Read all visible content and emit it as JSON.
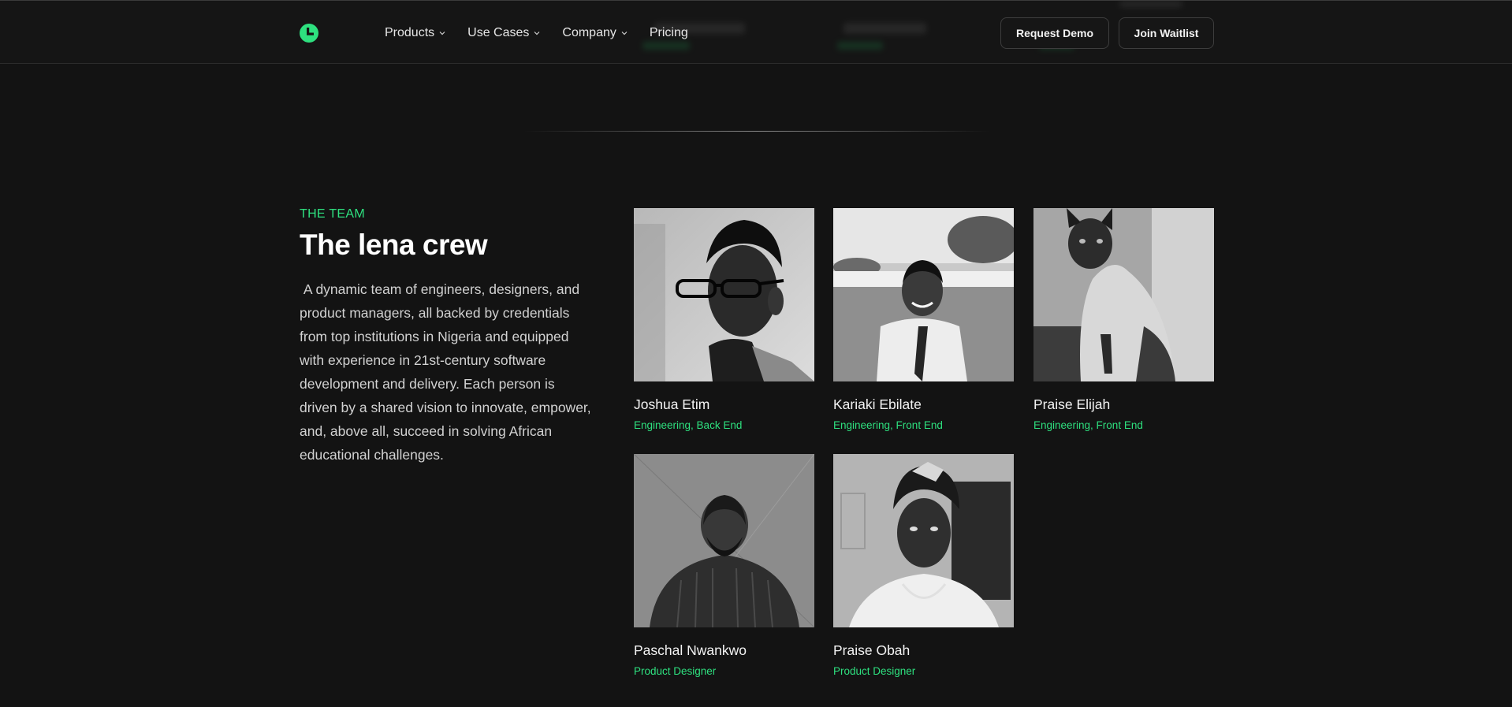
{
  "nav": {
    "items": [
      {
        "label": "Products",
        "has_dropdown": true
      },
      {
        "label": "Use Cases",
        "has_dropdown": true
      },
      {
        "label": "Company",
        "has_dropdown": true
      },
      {
        "label": "Pricing",
        "has_dropdown": false
      }
    ],
    "request_demo": "Request Demo",
    "join_waitlist": "Join Waitlist",
    "logo_icon": "lena-logo-icon"
  },
  "colors": {
    "background": "#131313",
    "accent": "#2ee07f",
    "text": "#e8e8e8"
  },
  "team": {
    "eyebrow": "THE TEAM",
    "title": "The lena crew",
    "description": " A dynamic team of engineers, designers, and product managers, all backed by credentials from top institutions in Nigeria and equipped with experience in 21st-century software development and delivery. Each person is driven by a shared vision to innovate, empower, and, above all, succeed in solving African educational challenges.",
    "members": [
      {
        "name": "Joshua Etim",
        "role": "Engineering, Back End"
      },
      {
        "name": "Kariaki Ebilate",
        "role": "Engineering, Front End"
      },
      {
        "name": "Praise Elijah",
        "role": "Engineering, Front End"
      },
      {
        "name": "Paschal Nwankwo",
        "role": "Product Designer"
      },
      {
        "name": "Praise Obah",
        "role": "Product Designer"
      }
    ]
  }
}
